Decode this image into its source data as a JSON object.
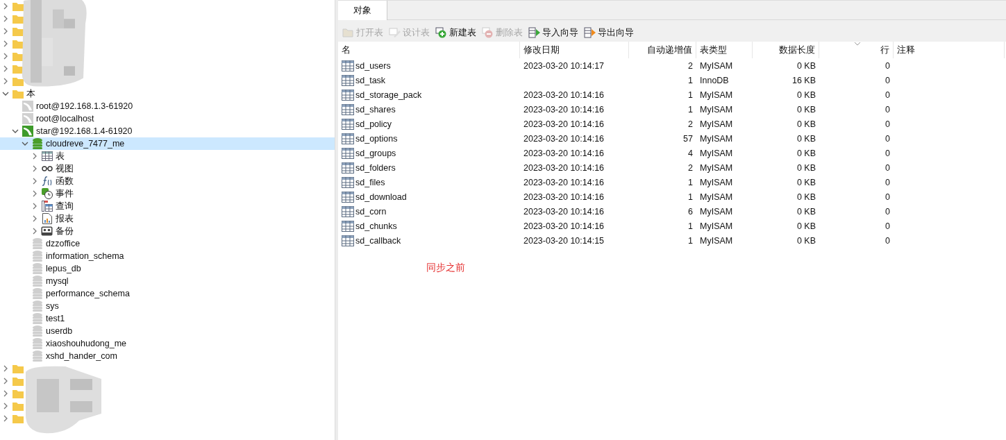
{
  "tree": [
    {
      "kind": "folder",
      "expanded": false
    },
    {
      "kind": "folder",
      "expanded": false
    },
    {
      "kind": "folder",
      "expanded": false
    },
    {
      "kind": "folder",
      "expanded": false
    },
    {
      "kind": "folder",
      "expanded": false
    },
    {
      "kind": "folder",
      "expanded": false
    },
    {
      "kind": "folder",
      "expanded": false
    },
    {
      "kind": "folder",
      "label": "本",
      "expanded": true,
      "children": [
        {
          "kind": "connection",
          "label": "root@192.168.1.3-61920",
          "active": false
        },
        {
          "kind": "connection",
          "label": "root@localhost",
          "active": false
        },
        {
          "kind": "connection",
          "label": "star@192.168.1.4-61920",
          "active": true,
          "expanded": true,
          "children": [
            {
              "kind": "database",
              "label": "cloudreve_7477_me",
              "open": true,
              "selected": true,
              "expanded": true,
              "children": [
                {
                  "kind": "tables",
                  "label": "表",
                  "expanded": false
                },
                {
                  "kind": "views",
                  "label": "视图",
                  "expanded": false
                },
                {
                  "kind": "functions",
                  "label": "函数",
                  "expanded": false
                },
                {
                  "kind": "events",
                  "label": "事件",
                  "expanded": false
                },
                {
                  "kind": "queries",
                  "label": "查询",
                  "expanded": false
                },
                {
                  "kind": "reports",
                  "label": "报表",
                  "expanded": false
                },
                {
                  "kind": "backups",
                  "label": "备份",
                  "expanded": false
                }
              ]
            },
            {
              "kind": "database",
              "label": "dzzoffice",
              "open": false,
              "selected": false
            },
            {
              "kind": "database",
              "label": "information_schema",
              "open": false,
              "selected": false
            },
            {
              "kind": "database",
              "label": "lepus_db",
              "open": false,
              "selected": false
            },
            {
              "kind": "database",
              "label": "mysql",
              "open": false,
              "selected": false
            },
            {
              "kind": "database",
              "label": "performance_schema",
              "open": false,
              "selected": false
            },
            {
              "kind": "database",
              "label": "sys",
              "open": false,
              "selected": false
            },
            {
              "kind": "database",
              "label": "test1",
              "open": false,
              "selected": false
            },
            {
              "kind": "database",
              "label": "userdb",
              "open": false,
              "selected": false
            },
            {
              "kind": "database",
              "label": "xiaoshouhudong_me",
              "open": false,
              "selected": false
            },
            {
              "kind": "database",
              "label": "xshd_hander_com",
              "open": false,
              "selected": false
            }
          ]
        }
      ]
    },
    {
      "kind": "folder",
      "expanded": false
    },
    {
      "kind": "folder",
      "expanded": false
    },
    {
      "kind": "folder",
      "expanded": false
    },
    {
      "kind": "folder",
      "expanded": false
    },
    {
      "kind": "folder",
      "expanded": false
    }
  ],
  "tabs": [
    {
      "label": "对象",
      "selected": true
    }
  ],
  "toolbar": [
    {
      "kind": "open",
      "label": "打开表",
      "disabled": true
    },
    {
      "kind": "design",
      "label": "设计表",
      "disabled": true
    },
    {
      "kind": "new",
      "label": "新建表",
      "disabled": false
    },
    {
      "kind": "delete",
      "label": "删除表",
      "disabled": true
    },
    {
      "kind": "import",
      "label": "导入向导",
      "disabled": false
    },
    {
      "kind": "export",
      "label": "导出向导",
      "disabled": false
    }
  ],
  "table": {
    "columns": [
      {
        "label": "名"
      },
      {
        "label": "修改日期"
      },
      {
        "label": "自动递增值"
      },
      {
        "label": "表类型"
      },
      {
        "label": "数据长度"
      },
      {
        "label": "行",
        "sorted": true
      },
      {
        "label": "注释"
      }
    ],
    "rows": [
      [
        "sd_users",
        "2023-03-20 10:14:17",
        "2",
        "MyISAM",
        "0 KB",
        "0"
      ],
      [
        "sd_task",
        "",
        "1",
        "InnoDB",
        "16 KB",
        "0"
      ],
      [
        "sd_storage_pack",
        "2023-03-20 10:14:16",
        "1",
        "MyISAM",
        "0 KB",
        "0"
      ],
      [
        "sd_shares",
        "2023-03-20 10:14:16",
        "1",
        "MyISAM",
        "0 KB",
        "0"
      ],
      [
        "sd_policy",
        "2023-03-20 10:14:16",
        "2",
        "MyISAM",
        "0 KB",
        "0"
      ],
      [
        "sd_options",
        "2023-03-20 10:14:16",
        "57",
        "MyISAM",
        "0 KB",
        "0"
      ],
      [
        "sd_groups",
        "2023-03-20 10:14:16",
        "4",
        "MyISAM",
        "0 KB",
        "0"
      ],
      [
        "sd_folders",
        "2023-03-20 10:14:16",
        "2",
        "MyISAM",
        "0 KB",
        "0"
      ],
      [
        "sd_files",
        "2023-03-20 10:14:16",
        "1",
        "MyISAM",
        "0 KB",
        "0"
      ],
      [
        "sd_download",
        "2023-03-20 10:14:16",
        "1",
        "MyISAM",
        "0 KB",
        "0"
      ],
      [
        "sd_corn",
        "2023-03-20 10:14:16",
        "6",
        "MyISAM",
        "0 KB",
        "0"
      ],
      [
        "sd_chunks",
        "2023-03-20 10:14:16",
        "1",
        "MyISAM",
        "0 KB",
        "0"
      ],
      [
        "sd_callback",
        "2023-03-20 10:14:15",
        "1",
        "MyISAM",
        "0 KB",
        "0"
      ]
    ]
  },
  "annotation": "同步之前"
}
